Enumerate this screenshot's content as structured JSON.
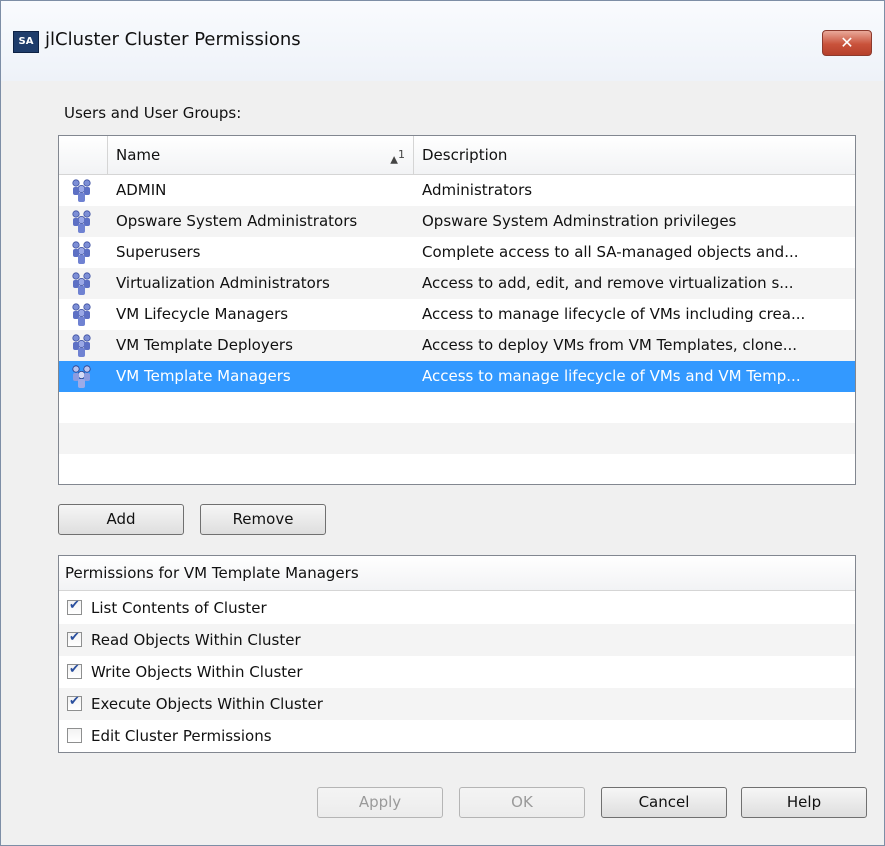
{
  "window": {
    "title": "jlCluster Cluster Permissions",
    "icon_text": "SA",
    "close_label": "✕"
  },
  "users_section": {
    "label": "Users and User Groups:"
  },
  "table": {
    "columns": {
      "name": "Name",
      "sort_indicator": "▲",
      "sort_order": "1",
      "description": "Description"
    },
    "rows": [
      {
        "name": "ADMIN",
        "description": "Administrators"
      },
      {
        "name": "Opsware System Administrators",
        "description": "Opsware System Adminstration privileges"
      },
      {
        "name": "Superusers",
        "description": "Complete access to all SA-managed objects and..."
      },
      {
        "name": "Virtualization Administrators",
        "description": "Access to add, edit, and remove virtualization s..."
      },
      {
        "name": "VM Lifecycle Managers",
        "description": "Access to manage lifecycle of VMs including crea..."
      },
      {
        "name": "VM Template Deployers",
        "description": "Access to deploy VMs from VM Templates, clone..."
      },
      {
        "name": "VM Template Managers",
        "description": "Access to manage lifecycle of VMs and VM Temp..."
      }
    ],
    "selected_index": 6
  },
  "actions": {
    "add_label": "Add",
    "remove_label": "Remove"
  },
  "permissions": {
    "header": "Permissions for VM Template Managers",
    "items": [
      {
        "label": "List Contents of Cluster",
        "checked": true
      },
      {
        "label": "Read Objects Within Cluster",
        "checked": true
      },
      {
        "label": "Write Objects Within Cluster",
        "checked": true
      },
      {
        "label": "Execute Objects Within Cluster",
        "checked": true
      },
      {
        "label": "Edit Cluster Permissions",
        "checked": false
      }
    ]
  },
  "footer": {
    "apply_label": "Apply",
    "ok_label": "OK",
    "cancel_label": "Cancel",
    "help_label": "Help"
  },
  "colors": {
    "selection": "#3399ff",
    "close_button": "#c9523b"
  }
}
